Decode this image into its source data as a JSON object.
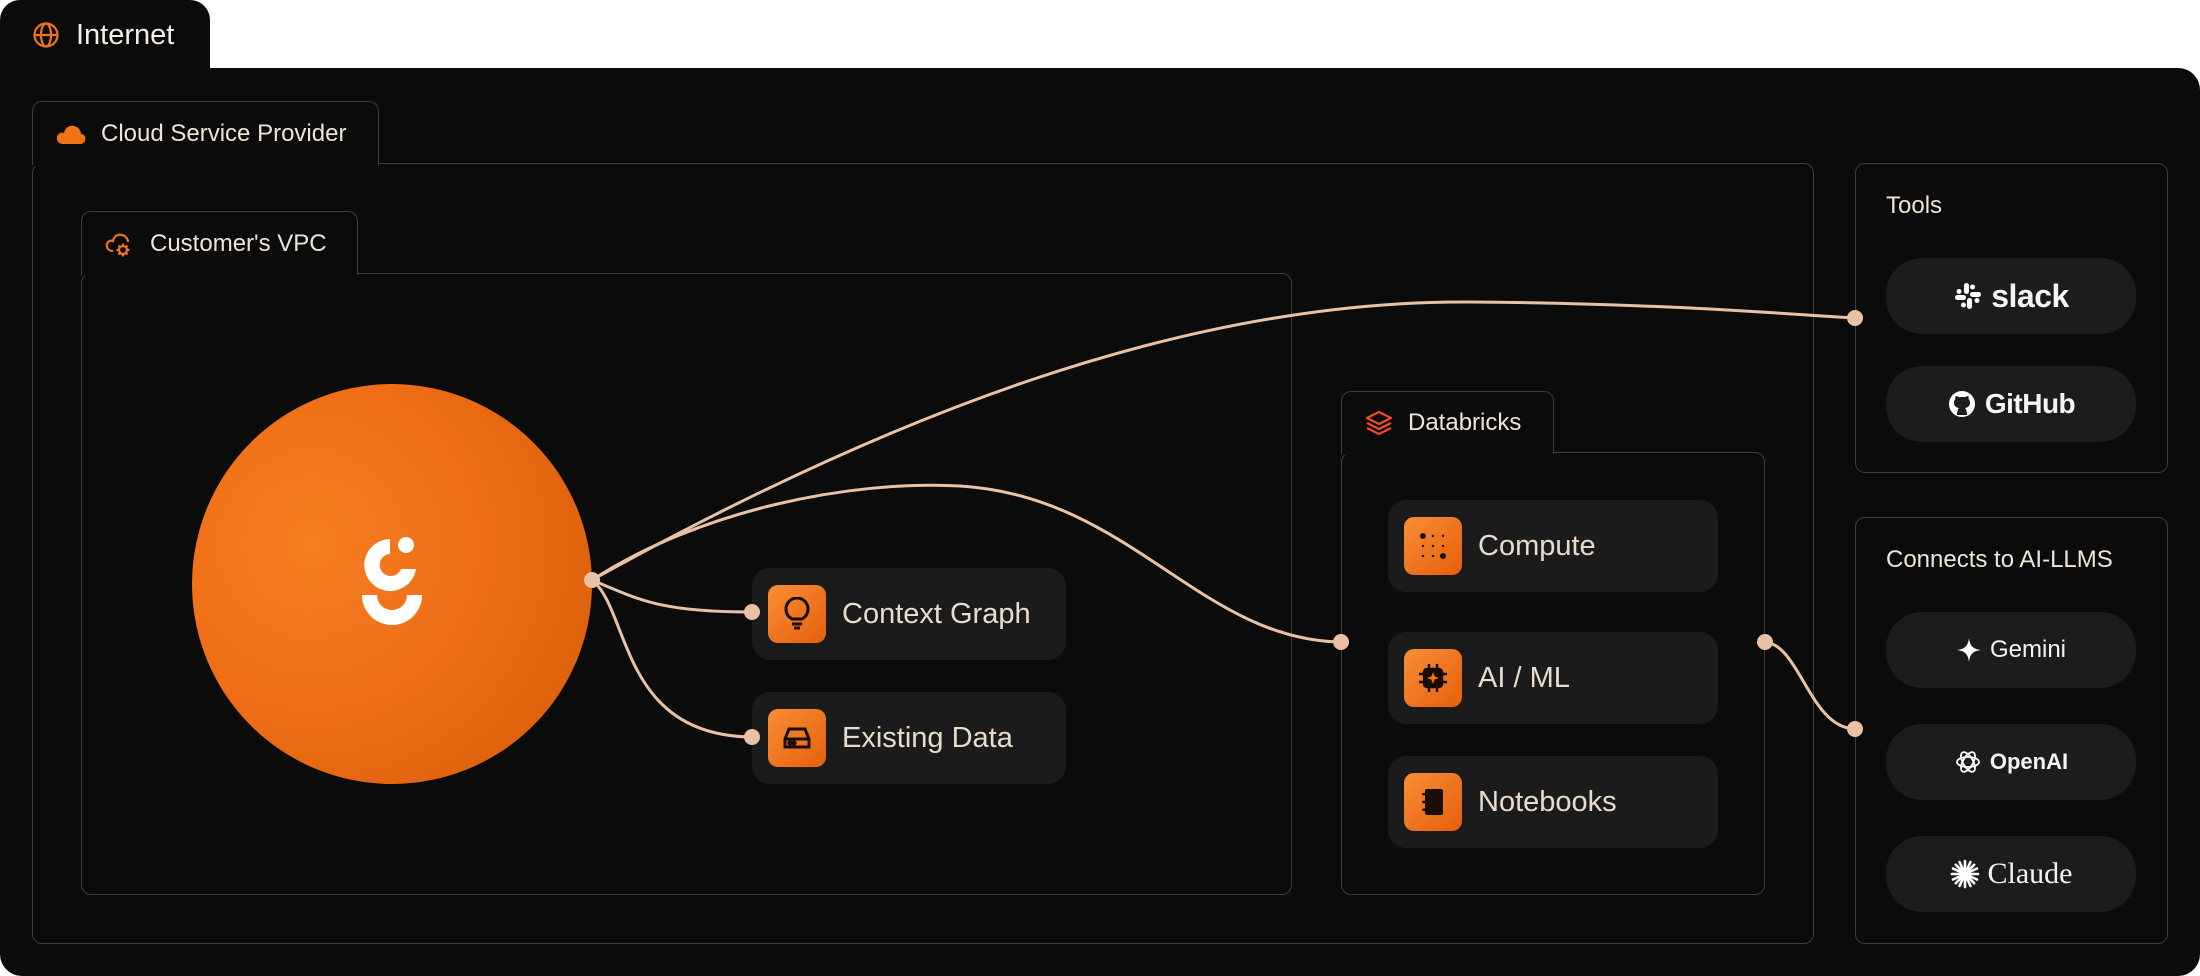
{
  "internet": {
    "label": "Internet",
    "icon": "globe-icon"
  },
  "cloud": {
    "label": "Cloud Service Provider",
    "icon": "cloud-icon"
  },
  "vpc": {
    "label": "Customer's VPC",
    "icon": "cloud-settings-icon",
    "hub_icon": "brand-logo",
    "items": [
      {
        "label": "Context Graph",
        "icon": "lightbulb-icon"
      },
      {
        "label": "Existing Data",
        "icon": "drive-icon"
      }
    ]
  },
  "databricks": {
    "label": "Databricks",
    "icon": "databricks-layers-icon",
    "items": [
      {
        "label": "Compute",
        "icon": "compute-grid-icon"
      },
      {
        "label": "AI / ML",
        "icon": "cpu-chip-icon"
      },
      {
        "label": "Notebooks",
        "icon": "notebook-icon"
      }
    ]
  },
  "tools": {
    "title": "Tools",
    "items": [
      {
        "label": "slack",
        "icon": "slack-icon"
      },
      {
        "label": "GitHub",
        "icon": "github-icon"
      }
    ]
  },
  "llms": {
    "title": "Connects to AI-LLMS",
    "items": [
      {
        "label": "Gemini",
        "icon": "gemini-sparkle-icon"
      },
      {
        "label": "OpenAI",
        "icon": "openai-icon"
      },
      {
        "label": "Claude",
        "icon": "claude-starburst-icon"
      }
    ]
  },
  "colors": {
    "background": "#0b0b0b",
    "accent_orange": "#f07318",
    "connector": "#e9c2a6",
    "border": "#3e3e3e",
    "pill": "#1c1c1c"
  }
}
